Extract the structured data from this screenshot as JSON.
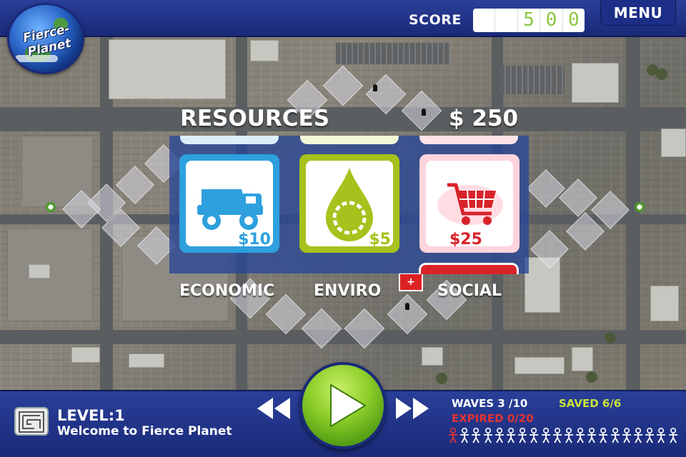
{
  "app": {
    "logo_text": "Fierce-Planet"
  },
  "score": {
    "label": "SCORE",
    "digits": [
      "",
      "",
      "5",
      "0",
      "0"
    ]
  },
  "menu": {
    "label": "MENU"
  },
  "resources": {
    "title": "RESOURCES",
    "money": "$ 250",
    "items": [
      {
        "category": "ECONOMIC",
        "icon": "dump-truck-icon",
        "price": "$10",
        "color": "#2ea0de"
      },
      {
        "category": "ENVIRO",
        "icon": "water-drop-recycle-icon",
        "price": "$5",
        "color": "#a7c11d"
      },
      {
        "category": "SOCIAL",
        "icon": "shopping-cart-icon",
        "price": "$25",
        "color": "#d8232a"
      }
    ]
  },
  "map": {
    "hospital_symbol": "+"
  },
  "level": {
    "label": "LEVEL:1",
    "description": "Welcome to Fierce Planet"
  },
  "stats": {
    "waves": "WAVES 3 /10",
    "saved": "SAVED 6/6",
    "expired": "EXPIRED 0/20",
    "saved_color": "#c9e13b",
    "expired_color": "#e23333",
    "agents_total": 20,
    "agents_highlighted": 1
  }
}
